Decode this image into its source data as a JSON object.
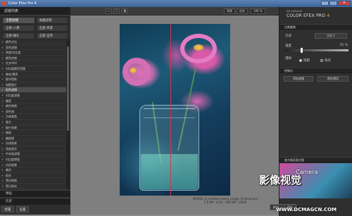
{
  "window": {
    "title": "Color Efex Pro 4",
    "buttons": {
      "minimize": "–",
      "maximize": "□",
      "close": "✕"
    }
  },
  "left_panel": {
    "header": "滤镜列表",
    "categories": [
      {
        "label": "全部滤镜",
        "active": true
      },
      {
        "label": "收藏滤镜",
        "active": false
      },
      {
        "label": "全部-人像",
        "active": false
      },
      {
        "label": "全部-风景",
        "active": false
      },
      {
        "label": "全部-婚礼",
        "active": false
      },
      {
        "label": "全部-自然",
        "active": false
      }
    ],
    "filters": [
      "颜色对比",
      "双色滤镜",
      "亮度/对比度",
      "颜色控制",
      "交叉冲印",
      "对比度颜色范围",
      "暗化/增亮",
      "细节提取",
      "电影胶片",
      "彩色滤镜",
      "对比度滤镜",
      "美容",
      "颜色转换",
      "双色调",
      "古典柔焦",
      "复古",
      "胶片效果",
      "暗角",
      "偏振镜",
      "光线效果",
      "亮度差异",
      "中灰度滤镜",
      "对比度增强",
      "仿旧效果",
      "着色",
      "阳光",
      "黑白转换",
      "黑白锐化",
      "人像美化",
      "分离色调",
      "单色滤镜",
      "彩色化"
    ],
    "selected_filter_index": 9,
    "bottom_sections": [
      "预设",
      "历史"
    ],
    "bottom_buttons": [
      "配置",
      "设置"
    ]
  },
  "toolbar": {
    "view_buttons": [
      "▭",
      "◫",
      "◨"
    ],
    "background_label": "背景",
    "zoom_label": "适合",
    "zoom_value": "100 %"
  },
  "canvas": {
    "caption_line1": "DCM10_4_creative_interp_image_finished.psd",
    "caption_line2": "1.6 MP · 8 bit · 300 DPI · sRGB"
  },
  "right_panel": {
    "brand_small": "Nik Software",
    "brand_name": "COLOR EFEX PRO",
    "brand_version": "4",
    "section_title": "古典柔焦",
    "method_label": "方式",
    "method_value": "方式 1",
    "strength_label": "强度",
    "strength_value": "25 %",
    "strength_fraction": 0.25,
    "diffusion_label": "漫射",
    "shadows_label": "暗部",
    "highlights_label": "高光",
    "control_points_label": "控制点",
    "add_filter_button": "添加滤镜",
    "create_preset_button": "保存预设",
    "preview_section": "放大镜及直方图"
  },
  "watermark": {
    "brand": "影像视觉",
    "camera": "Camera",
    "url": "WWW.DCMAGCN.COM"
  },
  "footer_buttons": [
    "取消",
    "保存"
  ]
}
